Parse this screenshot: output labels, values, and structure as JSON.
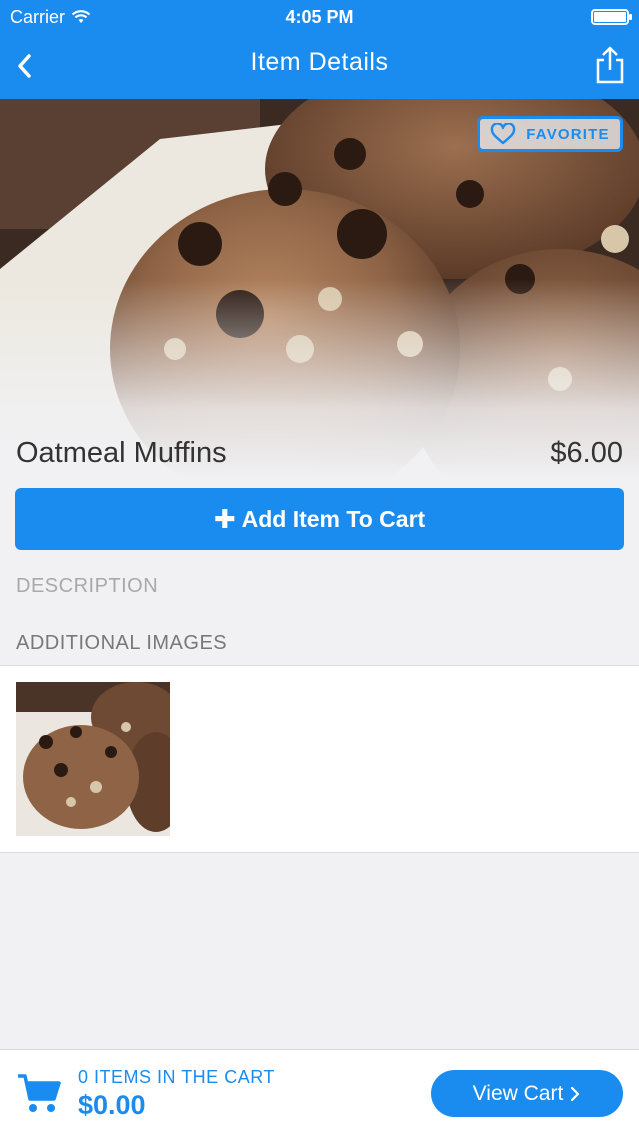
{
  "status_bar": {
    "carrier": "Carrier",
    "time": "4:05 PM"
  },
  "navbar": {
    "title": "Item Details",
    "back_icon": "chevron-left-icon",
    "share_icon": "share-icon"
  },
  "item": {
    "favorite_label": "FAVORITE",
    "name": "Oatmeal Muffins",
    "price": "$6.00",
    "add_to_cart_label": "Add Item To Cart"
  },
  "sections": {
    "description_label": "DESCRIPTION",
    "additional_images_label": "ADDITIONAL IMAGES"
  },
  "cart_bar": {
    "count_label": "0 ITEMS IN THE CART",
    "total": "$0.00",
    "view_cart_label": "View Cart"
  },
  "colors": {
    "accent": "#1a8cf0",
    "background": "#f1f1f3"
  }
}
